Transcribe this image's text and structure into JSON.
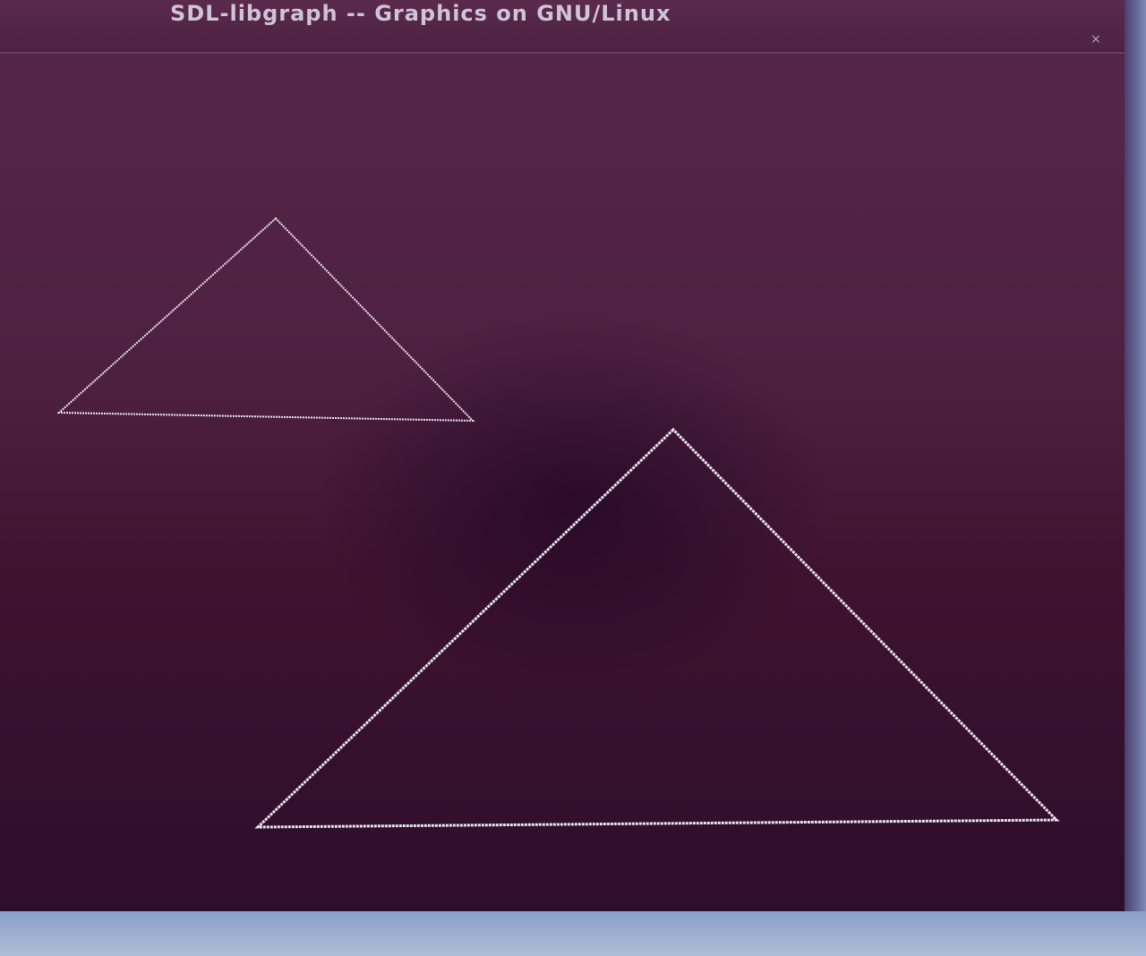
{
  "window": {
    "title": "SDL-libgraph -- Graphics on GNU/Linux",
    "close_symbol": "×"
  },
  "canvas": {
    "line_color": "#e8e8f0",
    "shapes": [
      {
        "name": "small-triangle",
        "type": "triangle"
      },
      {
        "name": "large-triangle",
        "type": "triangle"
      }
    ]
  }
}
